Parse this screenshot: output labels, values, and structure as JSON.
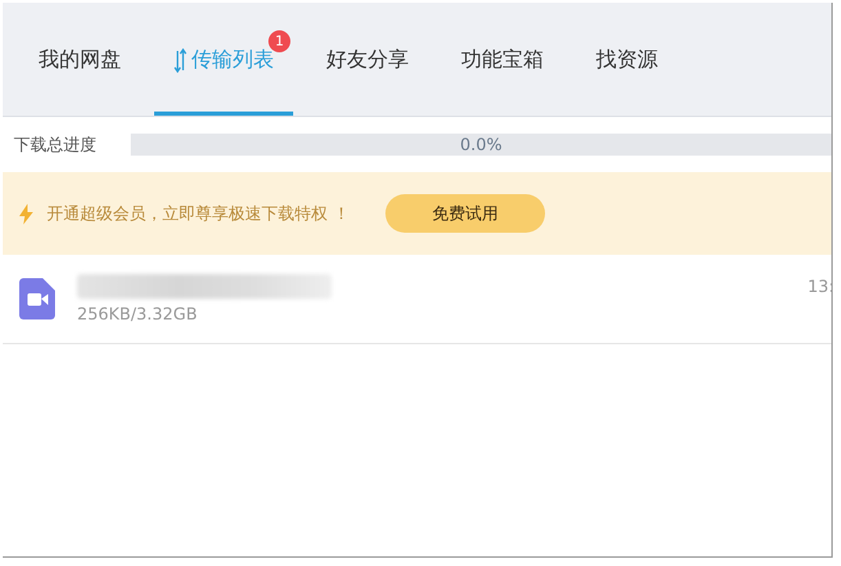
{
  "tabs": [
    {
      "label": "我的网盘",
      "selected": false
    },
    {
      "label": "传输列表",
      "selected": true,
      "badge": "1"
    },
    {
      "label": "好友分享",
      "selected": false
    },
    {
      "label": "功能宝箱",
      "selected": false
    },
    {
      "label": "找资源",
      "selected": false
    }
  ],
  "progress": {
    "label": "下载总进度",
    "reading": "0.0%"
  },
  "banner": {
    "text": "开通超级会员，立即尊享极速下载特权 ！",
    "button": "免费试用"
  },
  "transfers": [
    {
      "kind": "video",
      "size": "256KB/3.32GB",
      "time": "13:"
    }
  ]
}
